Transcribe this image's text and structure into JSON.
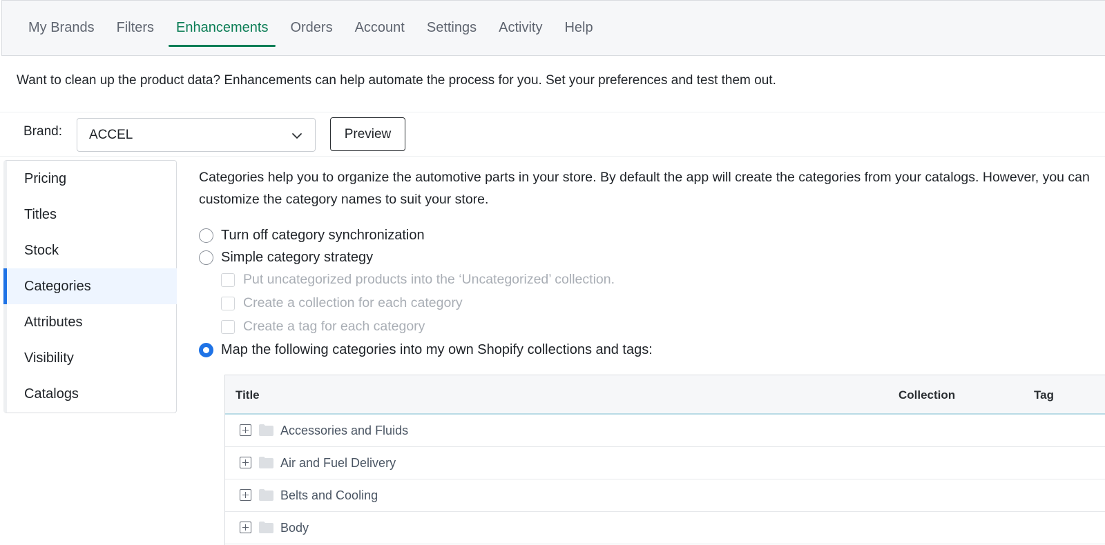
{
  "nav": {
    "tabs": [
      {
        "label": "My Brands"
      },
      {
        "label": "Filters"
      },
      {
        "label": "Enhancements"
      },
      {
        "label": "Orders"
      },
      {
        "label": "Account"
      },
      {
        "label": "Settings"
      },
      {
        "label": "Activity"
      },
      {
        "label": "Help"
      }
    ],
    "active": "Enhancements",
    "accent_color": "#0b7d55"
  },
  "intro": "Want to clean up the product data? Enhancements can help automate the process for you. Set your preferences and test them out.",
  "brand": {
    "label": "Brand:",
    "selected": "ACCEL",
    "preview_label": "Preview"
  },
  "sidebar": {
    "items": [
      {
        "label": "Pricing"
      },
      {
        "label": "Titles"
      },
      {
        "label": "Stock"
      },
      {
        "label": "Categories"
      },
      {
        "label": "Attributes"
      },
      {
        "label": "Visibility"
      },
      {
        "label": "Catalogs"
      }
    ],
    "active": "Categories",
    "accent_color": "#1f73e6"
  },
  "categories": {
    "description": "Categories help you to organize the automotive parts in your store. By default the app will create the categories from your catalogs. However, you can customize the category names to suit your store.",
    "options": [
      {
        "label": "Turn off category synchronization",
        "selected": false
      },
      {
        "label": "Simple category strategy",
        "selected": false
      },
      {
        "label": "Map the following categories into my own Shopify collections and tags:",
        "selected": true
      }
    ],
    "sub_options": [
      {
        "label": "Put uncategorized products into the ‘Uncategorized’ collection.",
        "checked": false,
        "disabled": true
      },
      {
        "label": "Create a collection for each category",
        "checked": false,
        "disabled": true
      },
      {
        "label": "Create a tag for each category",
        "checked": false,
        "disabled": true
      }
    ]
  },
  "table": {
    "columns": {
      "title": "Title",
      "collection": "Collection",
      "tag": "Tag"
    },
    "rows": [
      {
        "title": "Accessories and Fluids"
      },
      {
        "title": "Air and Fuel Delivery"
      },
      {
        "title": "Belts and Cooling"
      },
      {
        "title": "Body"
      }
    ]
  }
}
